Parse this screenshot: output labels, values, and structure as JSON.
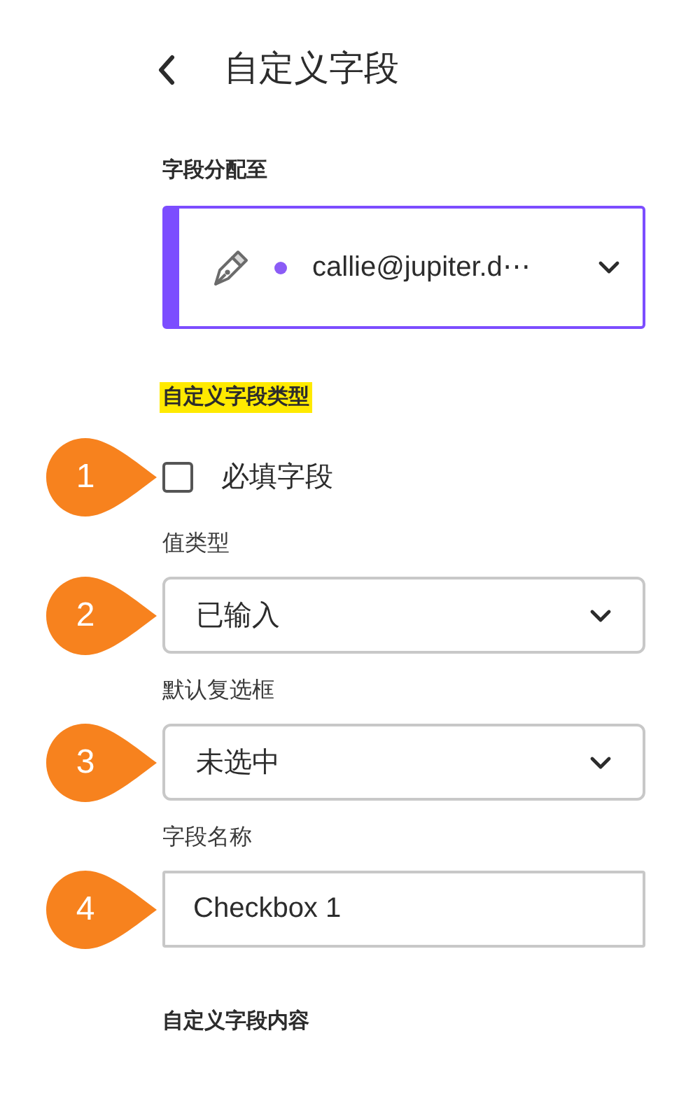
{
  "header": {
    "title": "自定义字段"
  },
  "assignment": {
    "label": "字段分配至",
    "value": "callie@jupiter.d⋯"
  },
  "field_type": {
    "heading": "自定义字段类型",
    "highlighted": true,
    "fields": [
      {
        "kind": "checkbox",
        "marker": "1",
        "label": "必填字段",
        "checked": false
      },
      {
        "kind": "select",
        "marker": "2",
        "label": "值类型",
        "value": "已输入"
      },
      {
        "kind": "select",
        "marker": "3",
        "label": "默认复选框",
        "value": "未选中"
      },
      {
        "kind": "text",
        "marker": "4",
        "label": "字段名称",
        "value": "Checkbox 1"
      }
    ]
  },
  "content_section": {
    "heading": "自定义字段内容"
  }
}
